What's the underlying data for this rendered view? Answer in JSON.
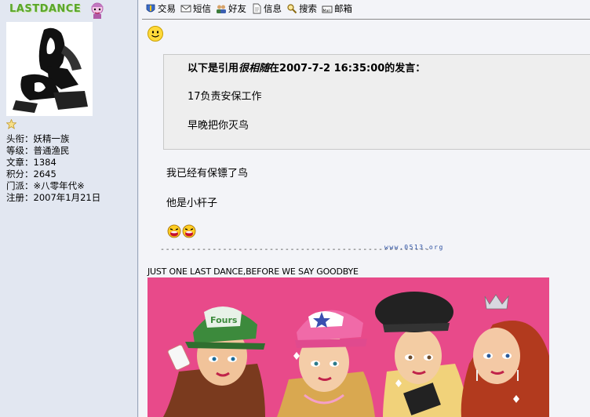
{
  "user": {
    "name": "LASTDANCE",
    "info": [
      {
        "label": "头衔：",
        "value": "妖精一族"
      },
      {
        "label": "等级：",
        "value": "普通渔民"
      },
      {
        "label": "文章：",
        "value": "1384"
      },
      {
        "label": "积分：",
        "value": "2645"
      },
      {
        "label": "门派：",
        "value": "※八零年代※"
      },
      {
        "label": "注册：",
        "value": "2007年1月21日"
      }
    ]
  },
  "toolbar": [
    {
      "label": "交易",
      "icon": "trade-icon"
    },
    {
      "label": "短信",
      "icon": "envelope-icon"
    },
    {
      "label": "好友",
      "icon": "friends-icon"
    },
    {
      "label": "信息",
      "icon": "document-icon"
    },
    {
      "label": "搜索",
      "icon": "search-icon"
    },
    {
      "label": "邮箱",
      "icon": "mail-icon"
    }
  ],
  "quote": {
    "prefix": "以下是引用",
    "author": "很相随",
    "middle": "在2007-7-2 16:35:00的发言：",
    "lines": [
      "17负责安保工作",
      "早晚把你灭鸟"
    ]
  },
  "reply": {
    "lines": [
      "我已经有保镖了鸟",
      "他是小杆子"
    ]
  },
  "signature": {
    "url": "www.0513.org",
    "dashes": "----------------------------------------------------",
    "text": "JUST ONE LAST DANCE,BEFORE WE SAY GOODBYE"
  },
  "colors": {
    "username": "#5aa62a",
    "banner_bg": "#e84a8a",
    "sidebar_bg": "#e2e7f1"
  }
}
